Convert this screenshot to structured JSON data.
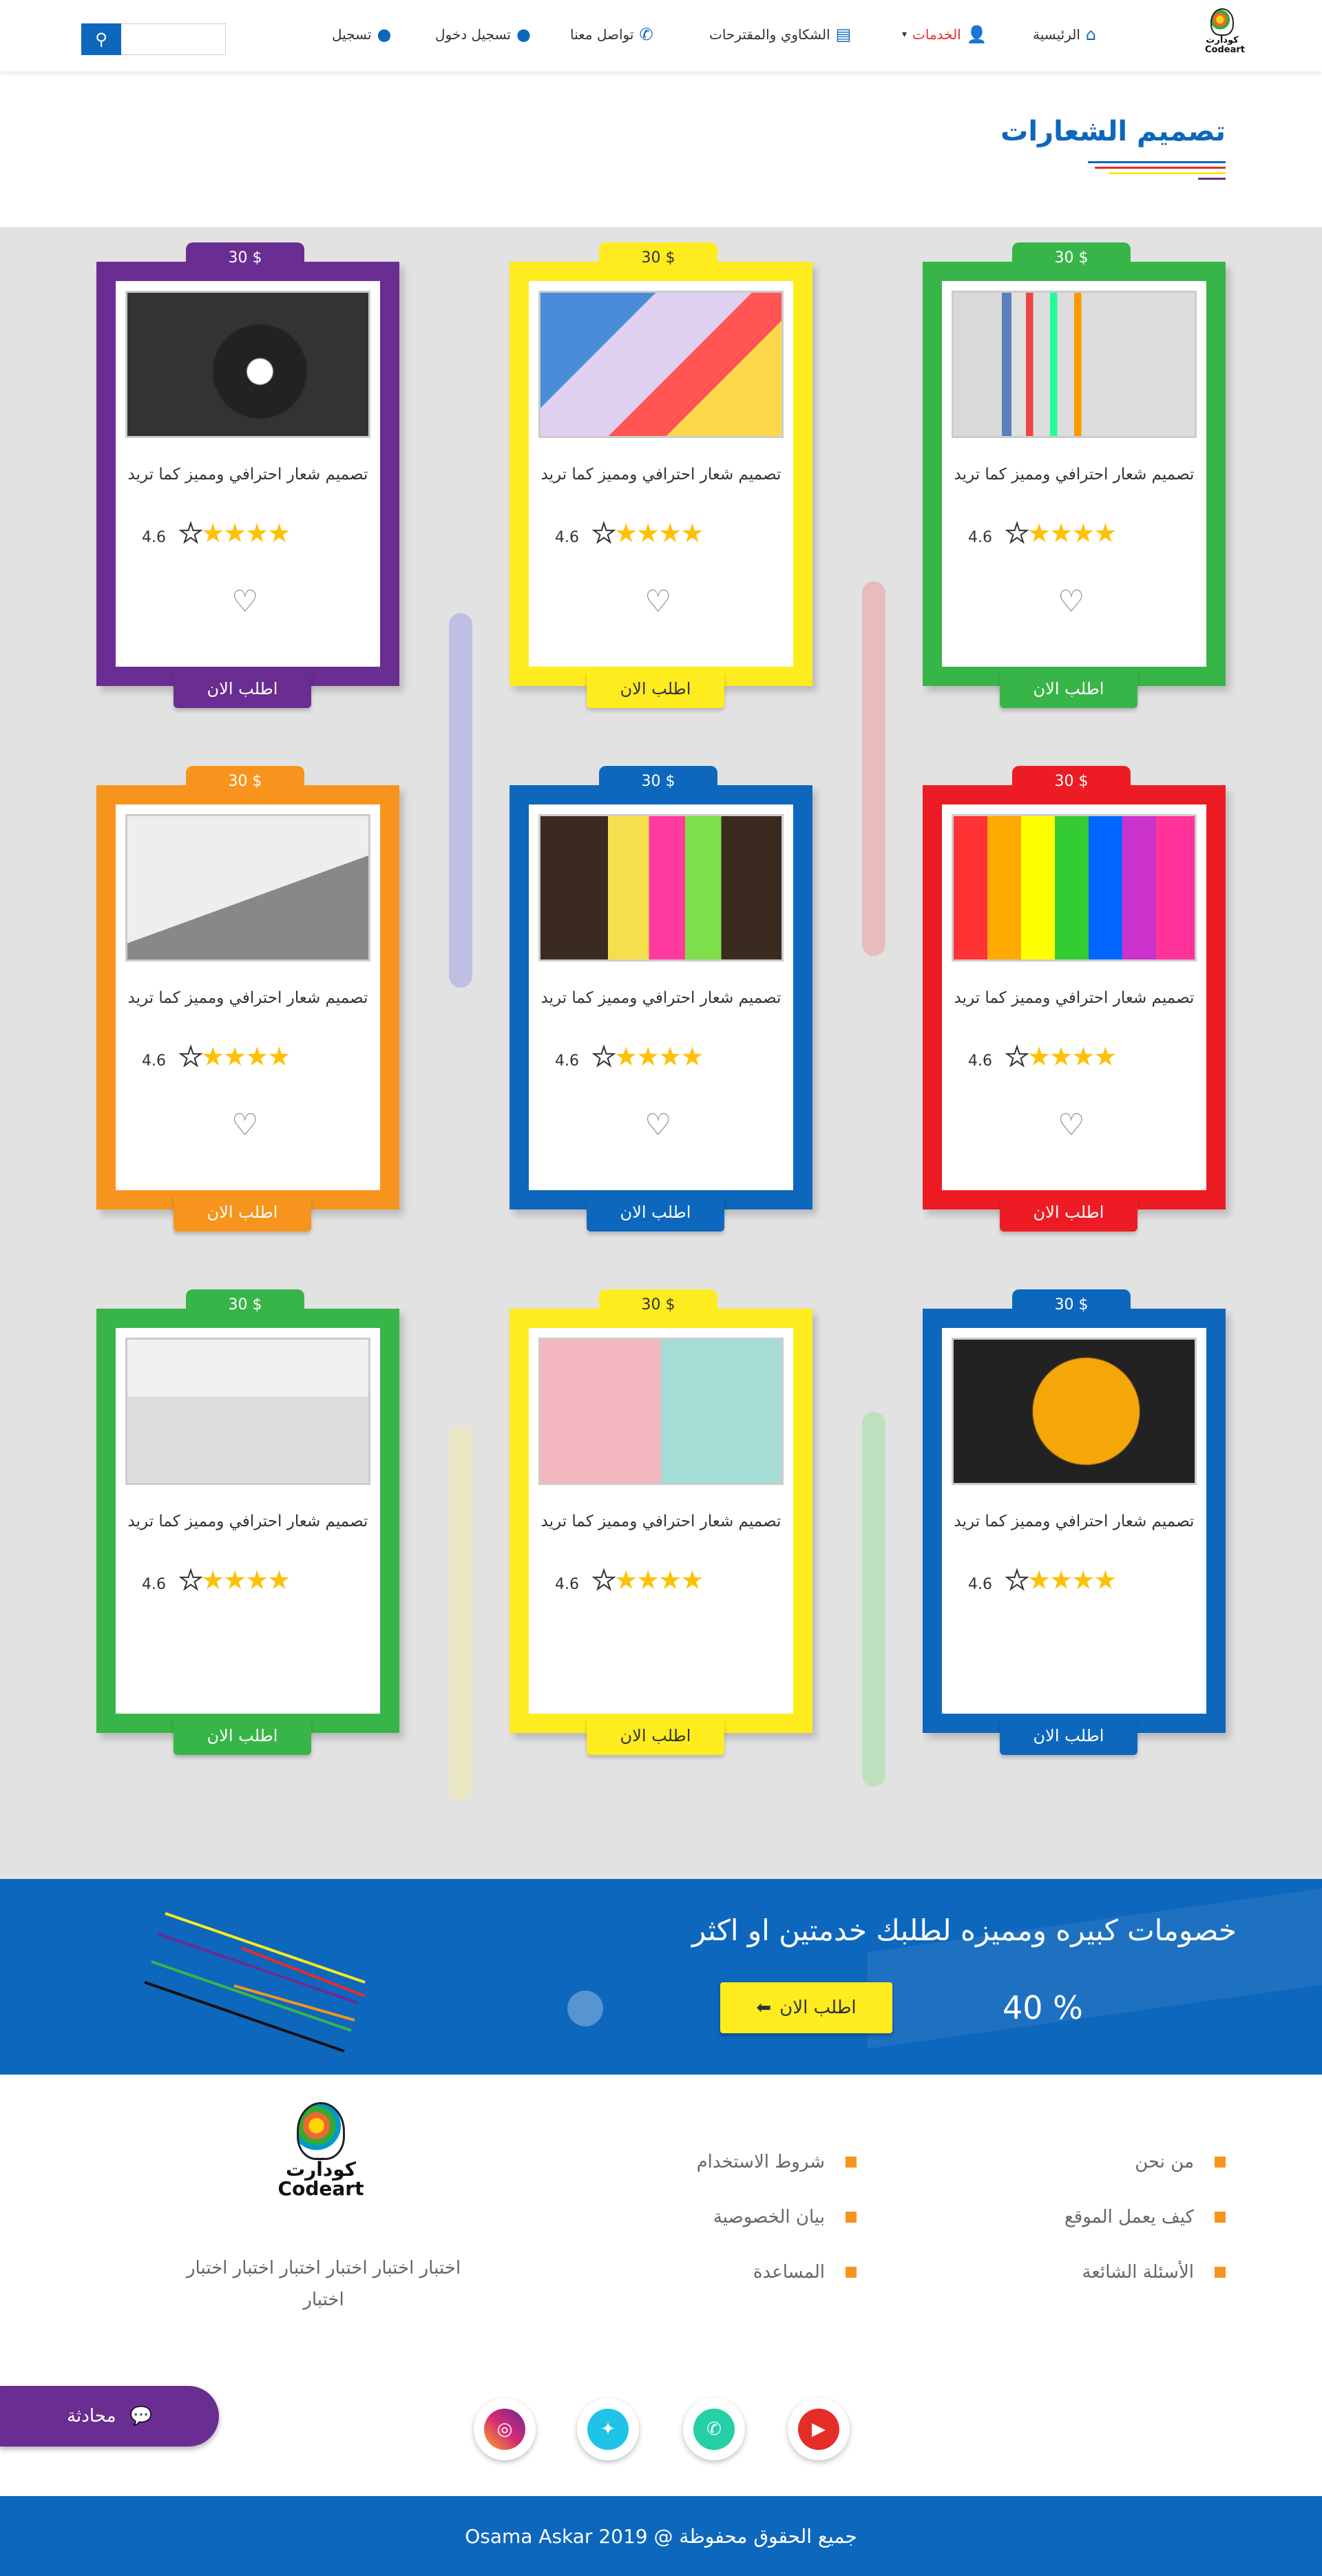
{
  "header": {
    "logo_text": "كودآرت",
    "logo_latin": "Codeart",
    "nav": [
      {
        "label": "الرئيسية",
        "icon": "home-icon"
      },
      {
        "label": "الخدمات",
        "icon": "services-icon"
      },
      {
        "label": "الشكاوي والمقترحات",
        "icon": "document-icon"
      },
      {
        "label": "تواصل معنا",
        "icon": "phone-icon"
      },
      {
        "label": "تسجيل دخول",
        "icon": "user-icon"
      },
      {
        "label": "تسجيل",
        "icon": "user-add-icon"
      }
    ],
    "search_placeholder": ""
  },
  "page": {
    "title": "تصميم الشعارات",
    "stripe_colors": [
      "#0d67bd",
      "#e52d2d",
      "#ffec1f",
      "#6a2d91"
    ]
  },
  "cards": [
    {
      "price": "30 $",
      "title": "تصميم شعار احترافي ومميز  كما تريد",
      "rating": "4.6",
      "order_label": "اطلب الان",
      "color": "#38b548",
      "photo": "pens"
    },
    {
      "price": "30 $",
      "title": "تصميم شعار احترافي ومميز  كما تريد",
      "rating": "4.6",
      "order_label": "اطلب الان",
      "color": "#ffec1f",
      "photo": "art-supplies"
    },
    {
      "price": "30 $",
      "title": "تصميم شعار احترافي ومميز  كما تريد",
      "rating": "4.6",
      "order_label": "اطلب الان",
      "color": "#6a2d91",
      "photo": "lightbulb-chalk"
    },
    {
      "price": "30 $",
      "title": "تصميم شعار احترافي ومميز  كما تريد",
      "rating": "4.6",
      "order_label": "اطلب الان",
      "color": "#ed1c24",
      "photo": "paint-drips"
    },
    {
      "price": "30 $",
      "title": "تصميم شعار احترافي ومميز  كما تريد",
      "rating": "4.6",
      "order_label": "اطلب الان",
      "color": "#0d67bd",
      "photo": "sticky-notes"
    },
    {
      "price": "30 $",
      "title": "تصميم شعار احترافي ومميز  كما تريد",
      "rating": "4.6",
      "order_label": "اطلب الان",
      "color": "#f7941d",
      "photo": "notebook"
    },
    {
      "price": "30 $",
      "title": "تصميم شعار احترافي ومميز  كما تريد",
      "rating": "4.6",
      "order_label": "اطلب الان",
      "color": "#0d67bd",
      "photo": "shirt"
    },
    {
      "price": "30 $",
      "title": "تصميم شعار احترافي ومميز  كما تريد",
      "rating": "4.6",
      "order_label": "اطلب الان",
      "color": "#ffec1f",
      "photo": "bags"
    },
    {
      "price": "30 $",
      "title": "تصميم شعار احترافي ومميز  كما تريد",
      "rating": "4.6",
      "order_label": "اطلب الان",
      "color": "#38b548",
      "photo": "tags"
    }
  ],
  "banner": {
    "title": "خصومات كبيره ومميزه لطلبك خدمتين او اكثر",
    "button_label": "اطلب الان",
    "discount": "40 %"
  },
  "footer": {
    "links_col1": [
      "من نحن",
      "كيف يعمل الموقع",
      "الأسئلة الشائعة"
    ],
    "links_col2": [
      "شروط الاستخدام",
      "بيان الخصوصية",
      "المساعدة"
    ],
    "about_text": "اختبار اختبار اختبار اختبار اختبار اختبار اختبار",
    "social": [
      {
        "name": "youtube",
        "color": "#e52d27"
      },
      {
        "name": "whatsapp",
        "color": "#25d0a6"
      },
      {
        "name": "twitter",
        "color": "#1da1f2"
      },
      {
        "name": "instagram",
        "color": "#c13584"
      }
    ],
    "chat_label": "محادثة",
    "copyright": "جميع الحقوق محفوظة @ 2019  Osama Askar"
  }
}
